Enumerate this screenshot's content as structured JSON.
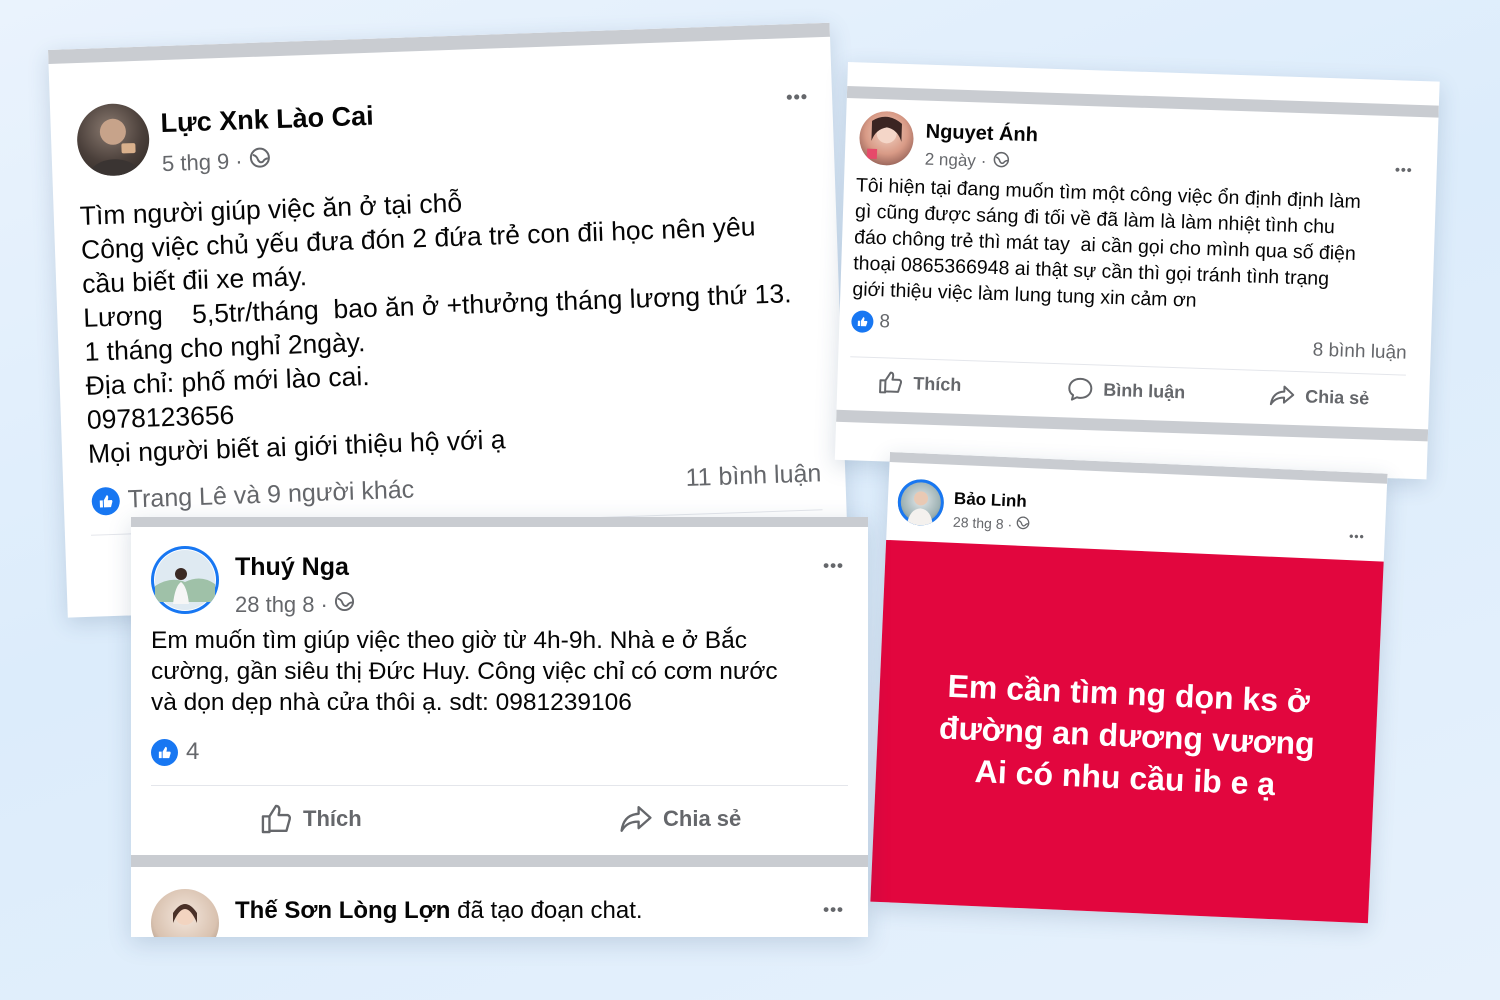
{
  "posts": [
    {
      "author": "Lực Xnk Lào Cai",
      "time": "5 thg 9",
      "dot": "·",
      "more": "•••",
      "lines": [
        "Tìm người giúp việc ăn ở tại chỗ",
        "Công việc chủ yếu đưa đón 2 đứa trẻ con đii học nên yêu",
        "cầu biết đii xe máy.",
        "Lương    5,5tr/tháng  bao ăn ở +thưởng tháng lương thứ 13.",
        "1 tháng cho nghỉ 2ngày.",
        "Địa chỉ: phố mới lào cai.",
        "0978123656",
        "Mọi người biết ai giới thiệu hộ với ạ"
      ],
      "reactions": "Trang Lê và 9 người khác",
      "comments": "11 bình luận"
    },
    {
      "author": "Nguyet Ánh",
      "time": "2 ngày",
      "dot": "·",
      "more": "•••",
      "lines": [
        "Tôi hiện tại đang muốn tìm một công việc ổn định định làm",
        "gì cũng được sáng đi tối về đã làm là làm nhiệt tình chu",
        "đáo chông trẻ thì mát tay  ai cần gọi cho mình qua số điện",
        "thoại 0865366948 ai thật sự cần thì gọi tránh tình trạng",
        "giới thiệu việc làm lung tung xin cảm ơn"
      ],
      "reactions": "8",
      "comments": "8 bình luận",
      "actions": {
        "like": "Thích",
        "comment": "Bình luận",
        "share": "Chia sẻ"
      }
    },
    {
      "author": "Thuý Nga",
      "time": "28 thg 8",
      "dot": "·",
      "more": "•••",
      "lines": [
        "Em muốn tìm giúp việc theo giờ từ 4h-9h. Nhà e ở Bắc",
        "cường, gần siêu thị Đức Huy. Công việc chỉ có cơm nước",
        "và dọn dẹp nhà cửa thôi ạ. sdt: 0981239106"
      ],
      "reactions": "4",
      "actions": {
        "like": "Thích",
        "share": "Chia sẻ"
      },
      "next_post": {
        "author": "Thế Sơn Lòng Lợn",
        "activity": " đã tạo đoạn chat.",
        "more": "•••"
      }
    },
    {
      "author": "Bảo Linh",
      "time": "28 thg 8",
      "dot": "·",
      "more": "•••",
      "banner_lines": [
        "Em cần tìm ng dọn ks ở",
        "đường an dương vương",
        "Ai có nhu cầu ib e ạ"
      ],
      "banner_color": "#e2063e"
    }
  ],
  "colors": {
    "facebook_blue": "#1877f2",
    "secondary_text": "#65676b"
  }
}
